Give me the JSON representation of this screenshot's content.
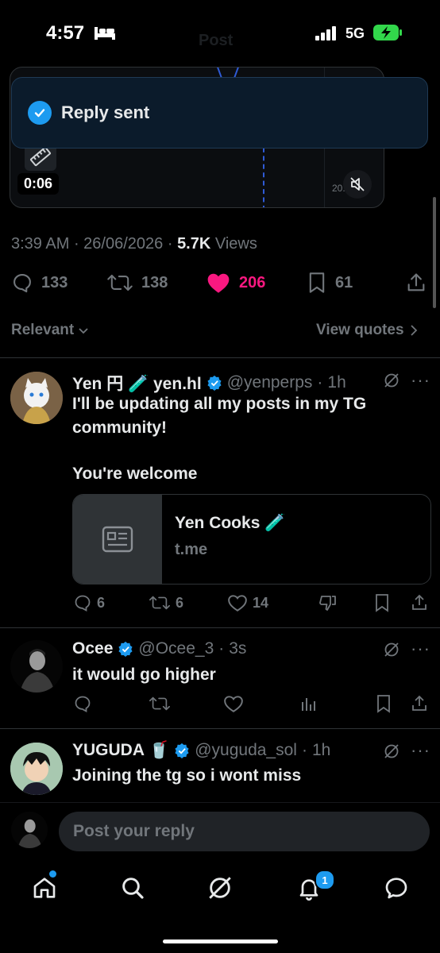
{
  "status_bar": {
    "time": "4:57",
    "network": "5G"
  },
  "header": {
    "title": "Post"
  },
  "video": {
    "duration": "0:06",
    "price_label": "20.0"
  },
  "toast": {
    "text": "Reply sent"
  },
  "post_meta": {
    "time": "3:39 AM",
    "date": "26/06/2026",
    "views_count": "5.7K",
    "views_label": "Views"
  },
  "stats": {
    "replies": "133",
    "reposts": "138",
    "likes": "206",
    "bookmarks": "61"
  },
  "sort": {
    "label": "Relevant",
    "view_quotes": "View quotes"
  },
  "replies": [
    {
      "name": "Yen 円 🧪 yen.hl",
      "handle": "@yenperps",
      "time": "1h",
      "text_line1": "I'll be updating all my posts in my TG",
      "text_line2": "community!",
      "text_line3": "You're welcome",
      "card_title": "Yen Cooks 🧪",
      "card_domain": "t.me",
      "replies": "6",
      "reposts": "6",
      "likes": "14"
    },
    {
      "name": "Ocee",
      "handle": "@Ocee_3",
      "time": "3s",
      "text_line1": "it would go higher"
    },
    {
      "name": "YUGUDA 🥤",
      "handle": "@yuguda_sol",
      "time": "1h",
      "text_line1": "Joining the tg so i wont miss"
    }
  ],
  "composer": {
    "placeholder": "Post your reply"
  },
  "tab_bar": {
    "notifications_badge": "1"
  },
  "colors": {
    "accent": "#1d9bf0",
    "like": "#f91880",
    "muted": "#71767b",
    "background": "#000000"
  }
}
